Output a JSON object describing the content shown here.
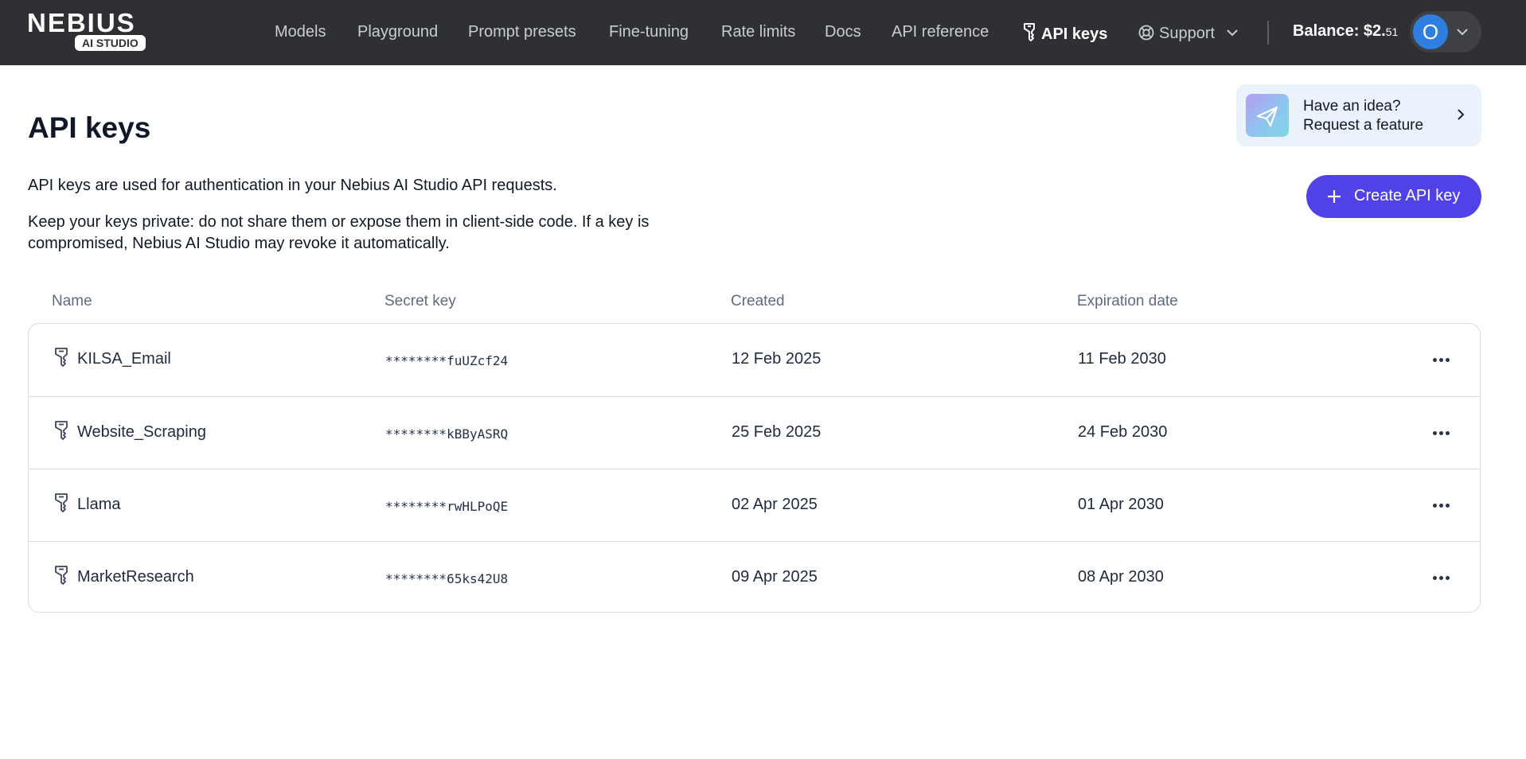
{
  "brand": {
    "name": "NEBIUS",
    "sub": "AI STUDIO"
  },
  "nav": {
    "items": [
      {
        "label": "Models"
      },
      {
        "label": "Playground"
      },
      {
        "label": "Prompt presets"
      },
      {
        "label": "Fine-tuning"
      },
      {
        "label": "Rate limits"
      },
      {
        "label": "Docs"
      },
      {
        "label": "API reference"
      },
      {
        "label": "API keys",
        "active": true,
        "icon": "key-icon"
      },
      {
        "label": "Support",
        "icon": "lifebuoy-icon",
        "dropdown": true
      }
    ],
    "balance_label": "Balance: $2.",
    "balance_cents": "51",
    "avatar_initial": "O"
  },
  "page": {
    "title": "API keys",
    "desc1": "API keys are used for authentication in your Nebius AI Studio API requests.",
    "desc2": "Keep your keys private: do not share them or expose them in client-side code. If a key is compromised, Nebius AI Studio may revoke it automatically."
  },
  "feature_card": {
    "line1": "Have an idea?",
    "line2": "Request a feature",
    "icon": "paper-plane-icon"
  },
  "create_button": {
    "label": "Create API key"
  },
  "table": {
    "headers": {
      "name": "Name",
      "secret": "Secret key",
      "created": "Created",
      "expiration": "Expiration date"
    },
    "rows": [
      {
        "name": "KILSA_Email",
        "secret": "********fuUZcf24",
        "created": "12 Feb 2025",
        "expiration": "11 Feb 2030"
      },
      {
        "name": "Website_Scraping",
        "secret": "********kBByASRQ",
        "created": "25 Feb 2025",
        "expiration": "24 Feb 2030"
      },
      {
        "name": "Llama",
        "secret": "********rwHLPoQE",
        "created": "02 Apr 2025",
        "expiration": "01 Apr 2030"
      },
      {
        "name": "MarketResearch",
        "secret": "********65ks42U8",
        "created": "09 Apr 2025",
        "expiration": "08 Apr 2030"
      }
    ]
  },
  "colors": {
    "topbar": "#2f3033",
    "accent": "#5142e8",
    "avatar": "#2f7fe0",
    "feature_card_bg": "#eaf3fc"
  }
}
